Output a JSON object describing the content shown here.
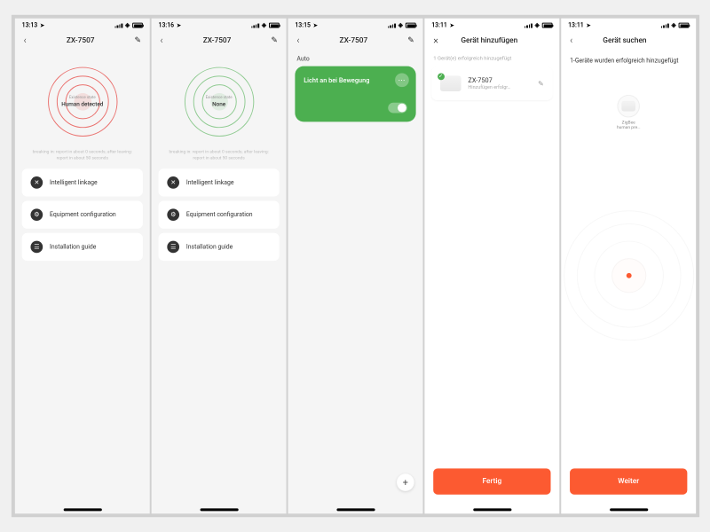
{
  "screens": [
    {
      "time": "13:13",
      "title": "ZX-7507",
      "radar_color": "red",
      "state_label": "Existence state",
      "state_value": "Human detected",
      "hint": "breaking in: report in about 0 seconds; after leaving: report in about 50 seconds",
      "menu": {
        "linkage": "Intelligent linkage",
        "config": "Equipment configuration",
        "guide": "Installation guide"
      }
    },
    {
      "time": "13:16",
      "title": "ZX-7507",
      "radar_color": "green",
      "state_label": "Existence state",
      "state_value": "None",
      "hint": "breaking in: report in about 0 seconds; after leaving: report in about 50 seconds",
      "menu": {
        "linkage": "Intelligent linkage",
        "config": "Equipment configuration",
        "guide": "Installation guide"
      }
    },
    {
      "time": "13:15",
      "title": "ZX-7507",
      "section": "Auto",
      "card_name": "Licht an bei Bewegung"
    },
    {
      "time": "13:11",
      "title": "Gerät hinzufügen",
      "subhint": "1 Gerät(e) erfolgreich hinzugefügt",
      "device_name": "ZX-7507",
      "device_sub": "Hinzufügen erfolgr…",
      "button": "Fertig"
    },
    {
      "time": "13:11",
      "title": "Gerät suchen",
      "headline": "1-Geräte wurden erfolgreich hinzugefügt",
      "found_proto": "ZigBee",
      "found_name": "human pre…",
      "button": "Weiter"
    }
  ],
  "colors": {
    "accent": "#fc5a31",
    "green": "#4caf50",
    "red": "#e53935"
  }
}
